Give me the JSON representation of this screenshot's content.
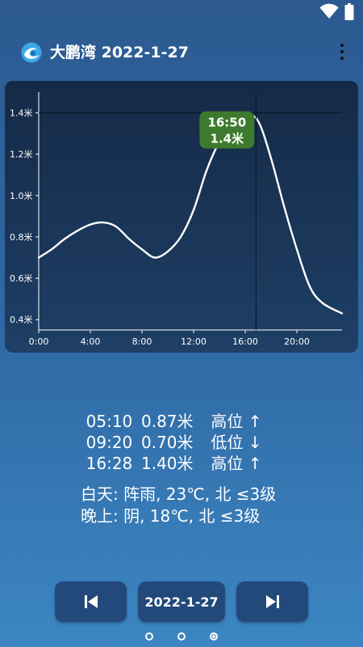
{
  "app": {
    "location": "大鹏湾",
    "date": "2022-1-27",
    "title": "大鹏湾 2022-1-27"
  },
  "colors": {
    "accent": "#22497a",
    "tooltip": "#3d7a2e",
    "curve": "#ffffff"
  },
  "chart_data": {
    "type": "line",
    "x_ticks": [
      "0:00",
      "4:00",
      "8:00",
      "12:00",
      "16:00",
      "20:00"
    ],
    "y_ticks": [
      "0.4米",
      "0.6米",
      "0.8米",
      "1.0米",
      "1.2米",
      "1.4米"
    ],
    "x_hours": [
      0,
      1,
      2,
      3,
      4,
      5,
      6,
      7,
      8,
      9,
      10,
      11,
      12,
      13,
      14,
      15,
      16,
      17,
      18,
      19,
      20,
      21,
      22,
      23.5
    ],
    "values": [
      0.7,
      0.74,
      0.79,
      0.83,
      0.86,
      0.87,
      0.85,
      0.79,
      0.74,
      0.7,
      0.73,
      0.8,
      0.93,
      1.12,
      1.26,
      1.34,
      1.39,
      1.36,
      1.18,
      0.95,
      0.74,
      0.56,
      0.48,
      0.43
    ],
    "xlim": [
      0,
      23.5
    ],
    "ylim": [
      0.35,
      1.5
    ],
    "grid": false,
    "tooltip": {
      "time": "16:50",
      "value": "1.4米",
      "hour": 16.833,
      "y": 1.4
    }
  },
  "tides": [
    {
      "time": "05:10",
      "height": "0.87米",
      "label": "高位 ↑"
    },
    {
      "time": "09:20",
      "height": "0.70米",
      "label": "低位 ↓"
    },
    {
      "time": "16:28",
      "height": "1.40米",
      "label": "高位 ↑"
    }
  ],
  "weather": {
    "day": "白天: 阵雨, 23℃, 北 ≤3级",
    "night": "晚上: 阴, 18℃, 北 ≤3级"
  },
  "nav": {
    "date_label": "2022-1-27"
  },
  "pages": {
    "count": 3,
    "active": 2
  }
}
